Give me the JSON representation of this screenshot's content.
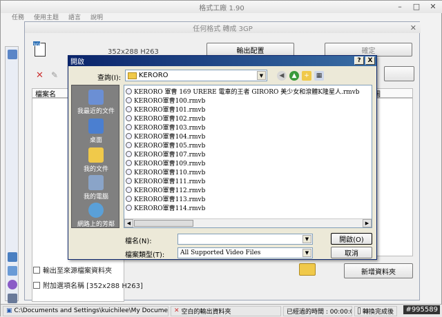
{
  "main_window": {
    "title": "格式工廠 1.90",
    "menu": [
      "任務",
      "使用主题",
      "語言",
      "說明"
    ]
  },
  "sub_window": {
    "title": "任何格式 轉成 3GP",
    "format_icon_label": "3GP",
    "resolution": "352x288 H263",
    "output_settings_button": "輸出配置",
    "ok_button": "確定",
    "column_filename": "檔案名",
    "column_right": "圖",
    "output_to_source_folder": "輸出至來源檔案資料夾",
    "append_option_name": "附加選項名稱 [352x288 H263]",
    "new_folder_button": "新增資料夾"
  },
  "status_bar": {
    "path": "C:\\Documents and Settings\\kuichilee\\My Documents\\FFOutput",
    "empty_output": "空白的輸出資料夾",
    "elapsed_label": "已經過的時間 : 00:00:00",
    "shutdown_label": "轉換完成後",
    "watermark": "#995589"
  },
  "dialog": {
    "title": "開啟",
    "help": "?",
    "close": "X",
    "look_in_label": "查詢(I):",
    "look_in_value": "KERORO",
    "places": [
      "我最近的文件",
      "桌面",
      "我的文件",
      "我的電腦",
      "網路上的芳鄰"
    ],
    "files": [
      "KERORO 軍曹 169 URERE 電車的王者 GIRORO 美少女和滾體K隆星人.rmvb",
      "KERORO軍曹100.rmvb",
      "KERORO軍曹101.rmvb",
      "KERORO軍曹102.rmvb",
      "KERORO軍曹103.rmvb",
      "KERORO軍曹104.rmvb",
      "KERORO軍曹105.rmvb",
      "KERORO軍曹107.rmvb",
      "KERORO軍曹109.rmvb",
      "KERORO軍曹110.rmvb",
      "KERORO軍曹111.rmvb",
      "KERORO軍曹112.rmvb",
      "KERORO軍曹113.rmvb",
      "KERORO軍曹114.rmvb"
    ],
    "filename_label": "檔名(N):",
    "filename_value": "",
    "filetype_label": "檔案類型(T):",
    "filetype_value": "All Supported Video Files",
    "open_button": "開啟(O)",
    "cancel_button": "取消"
  }
}
